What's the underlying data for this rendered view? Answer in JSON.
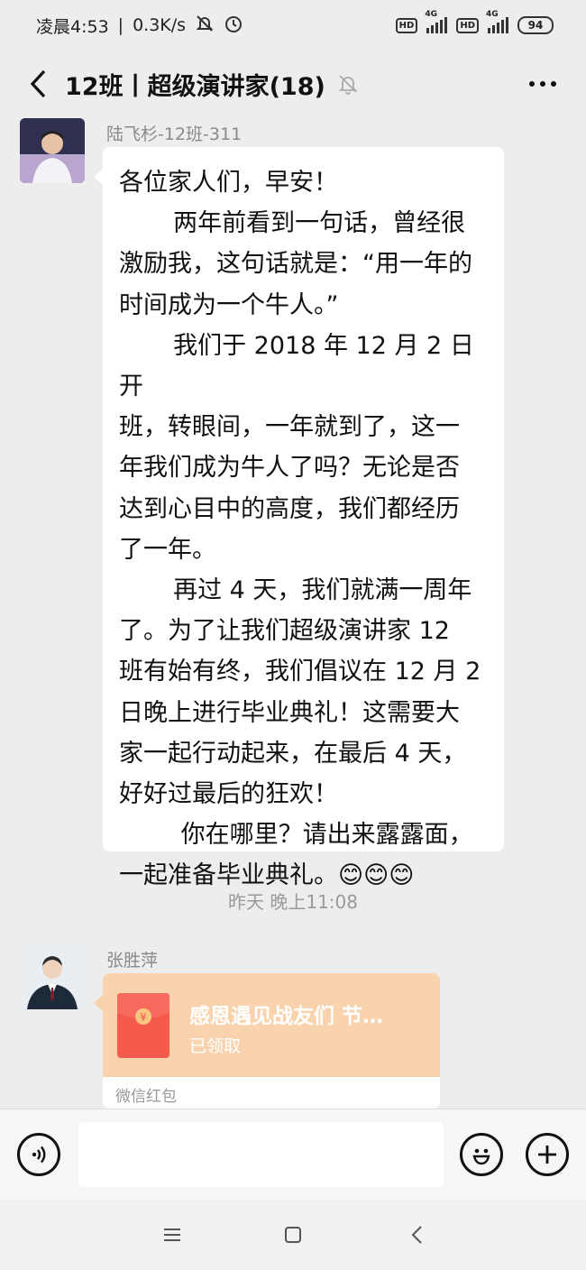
{
  "status_bar": {
    "time": "凌晨4:53",
    "speed": "0.3K/s",
    "hd_badge_1": "HD",
    "net_type_1": "4G",
    "hd_badge_2": "HD",
    "net_type_2": "4G",
    "battery": "94"
  },
  "header": {
    "title": "12班丨超级演讲家(18)"
  },
  "messages": [
    {
      "sender": "陆飞杉-12班-311",
      "text": "各位家人们，早安！\n       两年前看到一句话，曾经很\n激励我，这句话就是：“用一年的\n时间成为一个牛人。”\n       我们于 2018 年 12 月 2 日开\n班，转眼间，一年就到了，这一\n年我们成为牛人了吗？无论是否\n达到心目中的高度，我们都经历\n了一年。\n       再过 4 天，我们就满一周年\n了。为了让我们超级演讲家 12\n班有始有终，我们倡议在 12 月 2\n日晚上进行毕业典礼！这需要大\n家一起行动起来，在最后 4 天，\n好好过最后的狂欢！\n        你在哪里？请出来露露面，\n一起准备毕业典礼。😊😊😊"
    }
  ],
  "timestamp": "昨天 晚上11:08",
  "red_packet": {
    "sender": "张胜萍",
    "title": "感恩遇见战友们 节…",
    "status": "已领取",
    "footer": "微信红包",
    "accent": "#f9d3ad",
    "envelope_color": "#f45b4d"
  },
  "input": {
    "placeholder": ""
  }
}
